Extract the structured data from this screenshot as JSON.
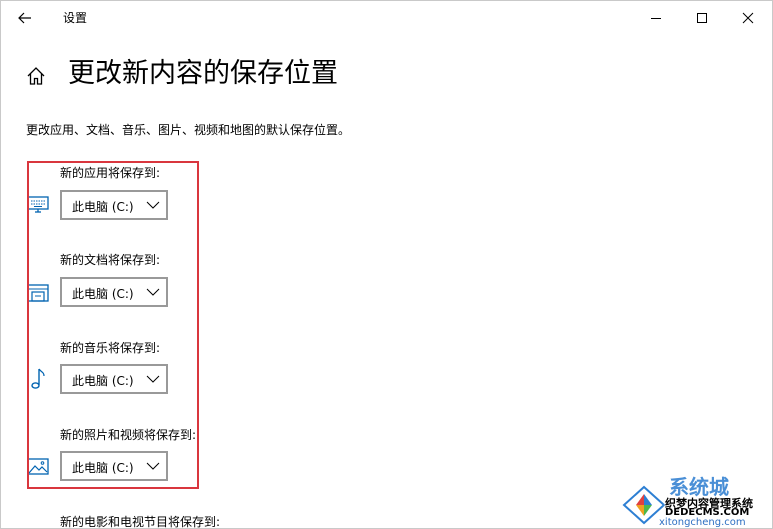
{
  "titlebar": {
    "title": "设置"
  },
  "page": {
    "title": "更改新内容的保存位置",
    "description": "更改应用、文档、音乐、图片、视频和地图的默认保存位置。"
  },
  "sections": [
    {
      "label": "新的应用将保存到:",
      "icon": "monitor-icon",
      "value": "此电脑 (C:)"
    },
    {
      "label": "新的文档将保存到:",
      "icon": "document-drive-icon",
      "value": "此电脑 (C:)"
    },
    {
      "label": "新的音乐将保存到:",
      "icon": "music-note-icon",
      "value": "此电脑 (C:)"
    },
    {
      "label": "新的照片和视频将保存到:",
      "icon": "picture-icon",
      "value": "此电脑 (C:)"
    },
    {
      "label": "新的电影和电视节目将保存到:"
    }
  ],
  "watermark": {
    "brand": "系统城",
    "line1": "织梦内容管理系统",
    "line2": "DEDECMS.COM",
    "line3": "xitongcheng.com"
  },
  "colors": {
    "accent": "#0063b1",
    "highlight": "#d9363e",
    "dropdown_border": "#999999"
  }
}
